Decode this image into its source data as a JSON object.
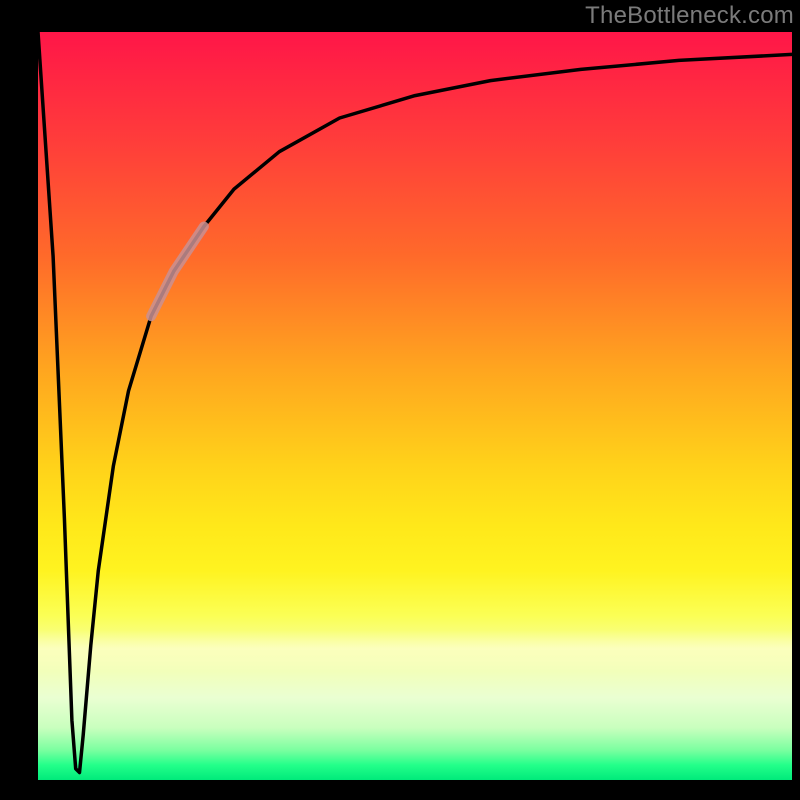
{
  "watermark": "TheBottleneck.com",
  "colors": {
    "frame": "#000000",
    "watermark_text": "#7b7b7b",
    "curve": "#000000",
    "highlight": "#c99093",
    "gradient_top": "#ff1648",
    "gradient_bottom": "#00ea7b"
  },
  "chart_data": {
    "type": "line",
    "title": "",
    "xlabel": "",
    "ylabel": "",
    "xlim": [
      0,
      100
    ],
    "ylim": [
      0,
      100
    ],
    "grid": false,
    "legend": false,
    "note": "Values are approximate, read from the plotted curve. X is horizontal position in % of plot width, Y is vertical position in % of plot height (0 = bottom, 100 = top). Curve drops sharply near x≈5 to y≈1 then rises asymptotically toward y≈97.",
    "series": [
      {
        "name": "curve",
        "x": [
          0,
          2,
          3.5,
          4.5,
          5,
          5.5,
          6,
          7,
          8,
          10,
          12,
          15,
          18,
          22,
          26,
          32,
          40,
          50,
          60,
          72,
          85,
          100
        ],
        "y": [
          100,
          70,
          35,
          8,
          1.5,
          1,
          6,
          18,
          28,
          42,
          52,
          62,
          68,
          74,
          79,
          84,
          88.5,
          91.5,
          93.5,
          95,
          96.2,
          97
        ],
        "highlight_x_range": [
          15,
          22
        ]
      }
    ]
  }
}
